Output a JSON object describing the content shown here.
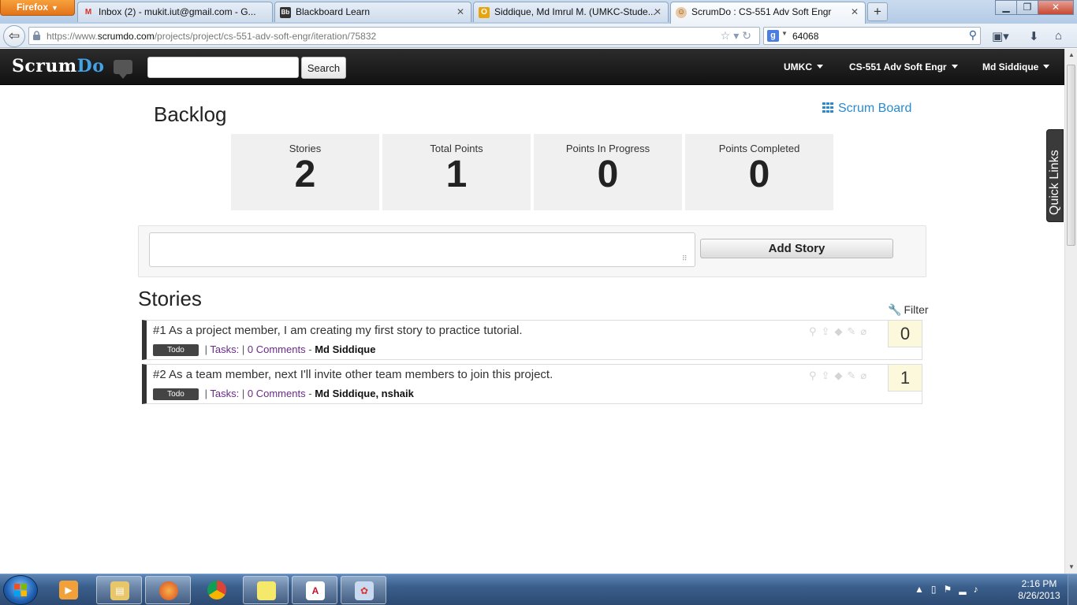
{
  "browser": {
    "menu_button": "Firefox",
    "tabs": [
      {
        "title": "Inbox (2) - mukit.iut@gmail.com - G...",
        "icon": "gmail-icon"
      },
      {
        "title": "Blackboard Learn",
        "icon": "blackboard-icon"
      },
      {
        "title": "Siddique, Md Imrul M. (UMKC-Stude...",
        "icon": "outlook-icon"
      },
      {
        "title": "ScrumDo : CS-551 Adv Soft Engr",
        "icon": "scrumdo-icon"
      }
    ],
    "new_tab": "+",
    "url_prefix": "https://www.",
    "url_domain": "scrumdo.com",
    "url_path": "/projects/project/cs-551-adv-soft-engr/iteration/75832",
    "search_query": "64068"
  },
  "app": {
    "brand_first": "Scrum",
    "brand_second": "Do",
    "search_button": "Search",
    "menus": [
      "UMKC",
      "CS-551 Adv Soft Engr",
      "Md Siddique"
    ]
  },
  "backlog": {
    "title": "Backlog",
    "scrum_board_link": "Scrum Board",
    "stats": [
      {
        "label": "Stories",
        "value": "2"
      },
      {
        "label": "Total Points",
        "value": "1"
      },
      {
        "label": "Points In Progress",
        "value": "0"
      },
      {
        "label": "Points Completed",
        "value": "0"
      }
    ],
    "add_story_button": "Add Story",
    "stories_heading": "Stories",
    "filter_link": "Filter",
    "stories": [
      {
        "title": "#1 As a project member, I am creating my first story to practice tutorial.",
        "status": "Todo",
        "tasks_sep": "|",
        "tasks": "Tasks:",
        "comments_sep": "|",
        "comments": "0 Comments",
        "owner_sep": "-",
        "owners": "Md Siddique",
        "points": "0"
      },
      {
        "title": "#2 As a team member, next I'll invite other team members to join this project.",
        "status": "Todo",
        "tasks_sep": "|",
        "tasks": "Tasks:",
        "comments_sep": "|",
        "comments": "0 Comments",
        "owner_sep": "-",
        "owners": "Md Siddique, nshaik",
        "points": "1"
      }
    ],
    "quick_links": "Quick Links"
  },
  "taskbar": {
    "time": "2:16 PM",
    "date": "8/26/2013"
  },
  "colors": {
    "accent": "#2a8ad0",
    "header_bg": "#1e1e1e",
    "points_bg": "#fcf8dc",
    "link_purple": "#6a2a8c"
  }
}
